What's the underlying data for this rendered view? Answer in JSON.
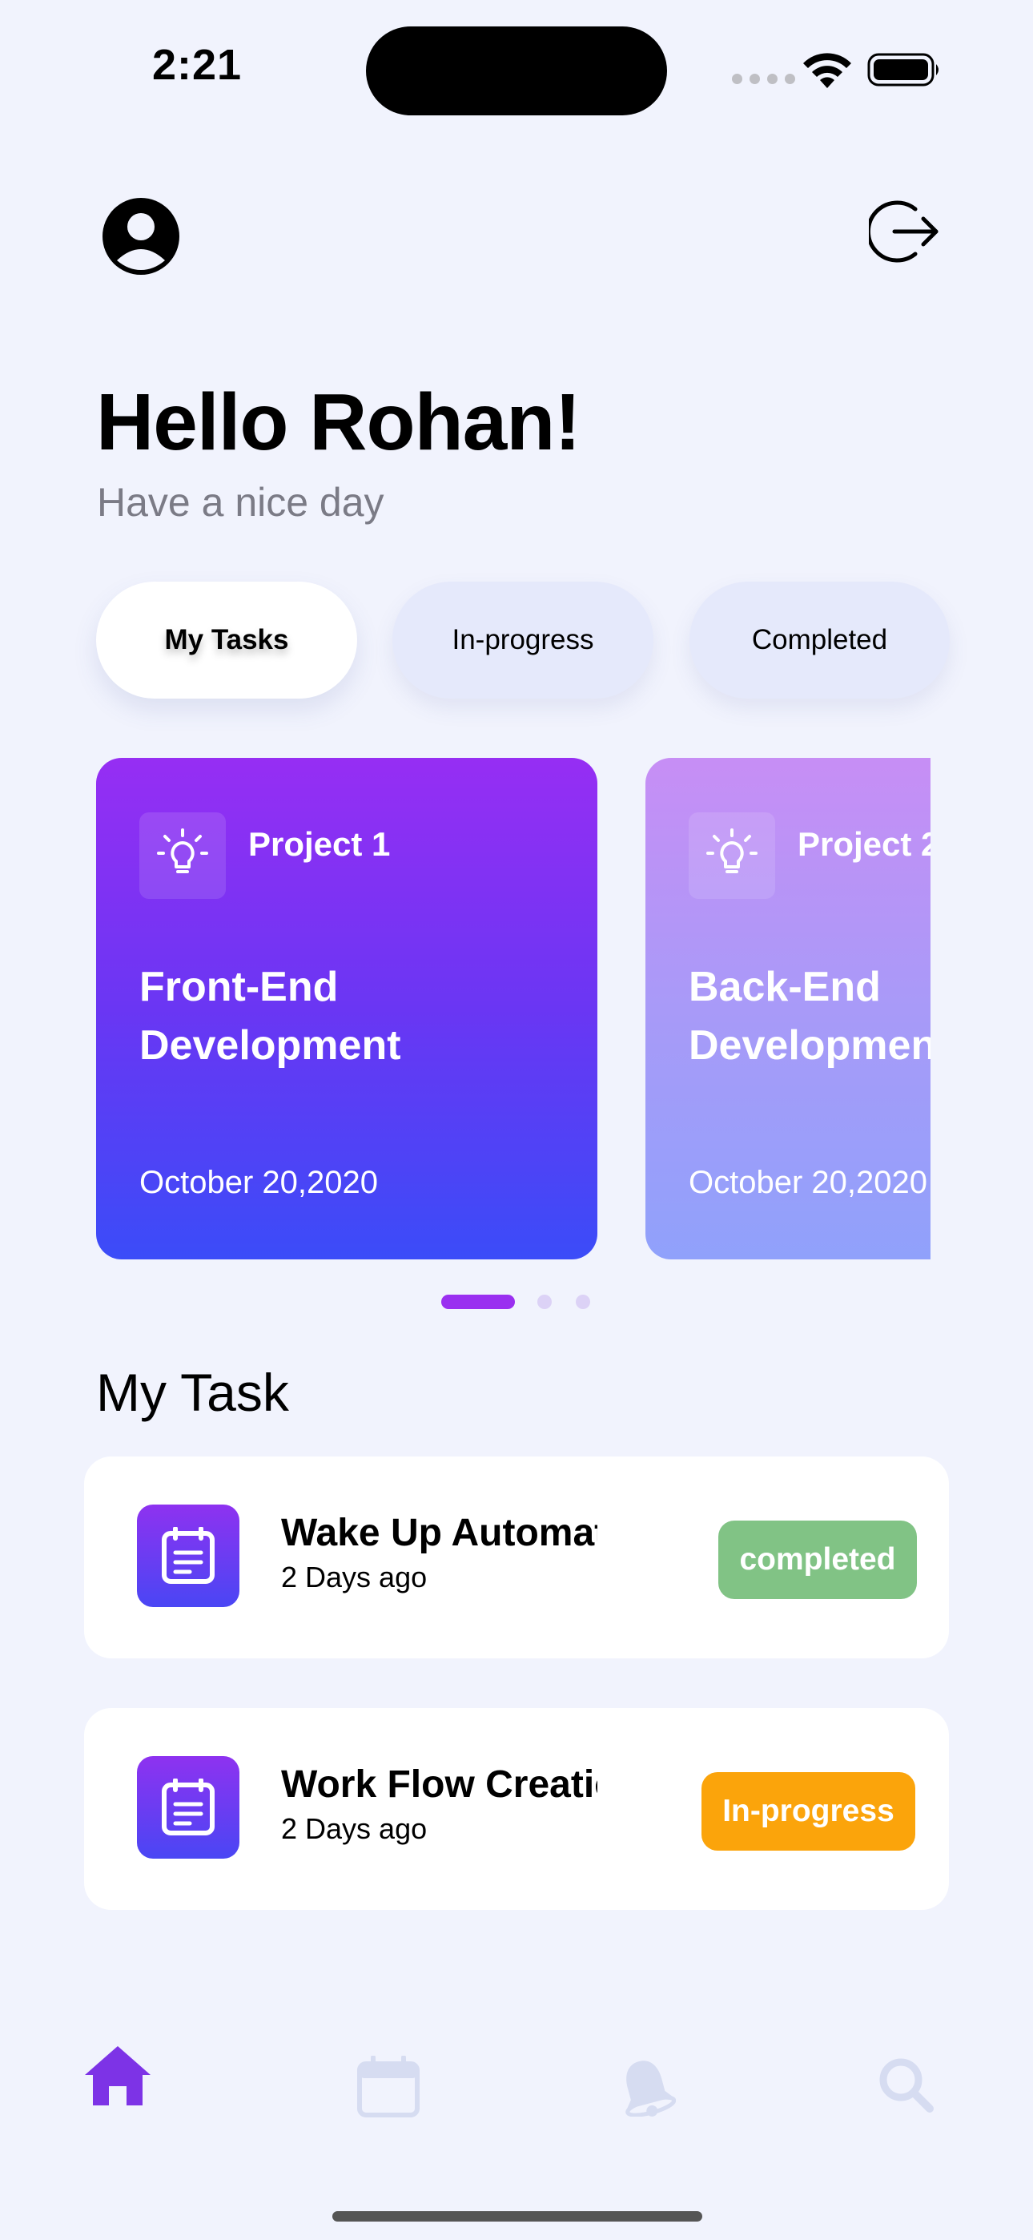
{
  "status_bar": {
    "time": "2:21"
  },
  "header": {
    "greeting": "Hello Rohan!",
    "subtitle": "Have a nice day"
  },
  "filters": [
    {
      "label": "My Tasks",
      "active": true
    },
    {
      "label": "In-progress",
      "active": false
    },
    {
      "label": "Completed",
      "active": false
    }
  ],
  "projects": [
    {
      "label": "Project 1",
      "title_line1": "Front-End",
      "title_line2": "Development",
      "date": "October 20,2020"
    },
    {
      "label": "Project 2",
      "title_line1": "Back-End",
      "title_line2": "Development",
      "date": "October 20,2020"
    }
  ],
  "carousel": {
    "active_index": 0,
    "count": 3
  },
  "section_title": "My Task",
  "tasks": [
    {
      "title": "Wake Up Automation",
      "time": "2 Days ago",
      "status": "completed",
      "status_color": "#81c385"
    },
    {
      "title": "Work Flow Creation",
      "time": "2 Days ago",
      "status": "In-progress",
      "status_color": "#fba40b"
    }
  ],
  "nav": {
    "items": [
      {
        "icon": "home-icon",
        "active": true
      },
      {
        "icon": "calendar-icon",
        "active": false
      },
      {
        "icon": "bell-icon",
        "active": false
      },
      {
        "icon": "search-icon",
        "active": false
      }
    ],
    "active_color": "#7d33e6",
    "inactive_color": "#d6dcf1"
  },
  "colors": {
    "background": "#f1f3fd",
    "accent": "#9a2ff0",
    "card_gradient_top": "#962ef3",
    "card_gradient_bottom": "#3b4cf8"
  }
}
